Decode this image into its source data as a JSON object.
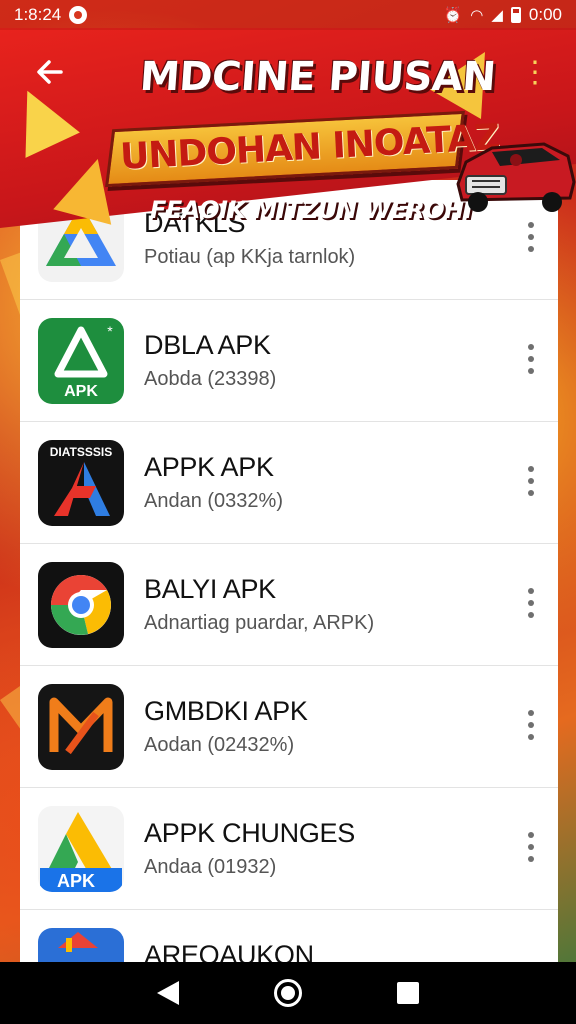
{
  "status_bar": {
    "time": "1:8:24",
    "right_time": "0:00",
    "icons": [
      "alarm-icon",
      "wifi-icon",
      "signal-icon",
      "battery-icon"
    ]
  },
  "banner": {
    "title": "MDCINE PIUSAN",
    "ribbon": "UNDOHAN INOATAZ",
    "subtitle": "FEAOIK MITZUN WEROHI"
  },
  "apps": [
    {
      "name": "DATKLS",
      "subtitle": "Potiau (ap KKja tarnlok)",
      "icon": "drive-style-icon"
    },
    {
      "name": "DBLA APK",
      "subtitle": "Aobda (23398)",
      "icon": "apk-green-icon"
    },
    {
      "name": "APPK APK",
      "subtitle": "Andan (0332%)",
      "icon": "arrow-a-dark-icon",
      "icon_label": "DIATSSSIS"
    },
    {
      "name": "BALYI APK",
      "subtitle": "Adnartiag puardar, ARPK)",
      "icon": "chrome-style-icon"
    },
    {
      "name": "GMBDKI APK",
      "subtitle": "Aodan (02432%)",
      "icon": "orange-m-icon"
    },
    {
      "name": "APPK CHUNGES",
      "subtitle": "Andaa (01932)",
      "icon": "apk-drive-icon",
      "icon_label": "APK"
    },
    {
      "name": "AREOAUKON",
      "subtitle": "",
      "icon": "red-blue-icon"
    }
  ],
  "colors": {
    "banner_red": "#e8231d",
    "ribbon_gold": "#f6c23a",
    "background_red": "#d8361e"
  }
}
